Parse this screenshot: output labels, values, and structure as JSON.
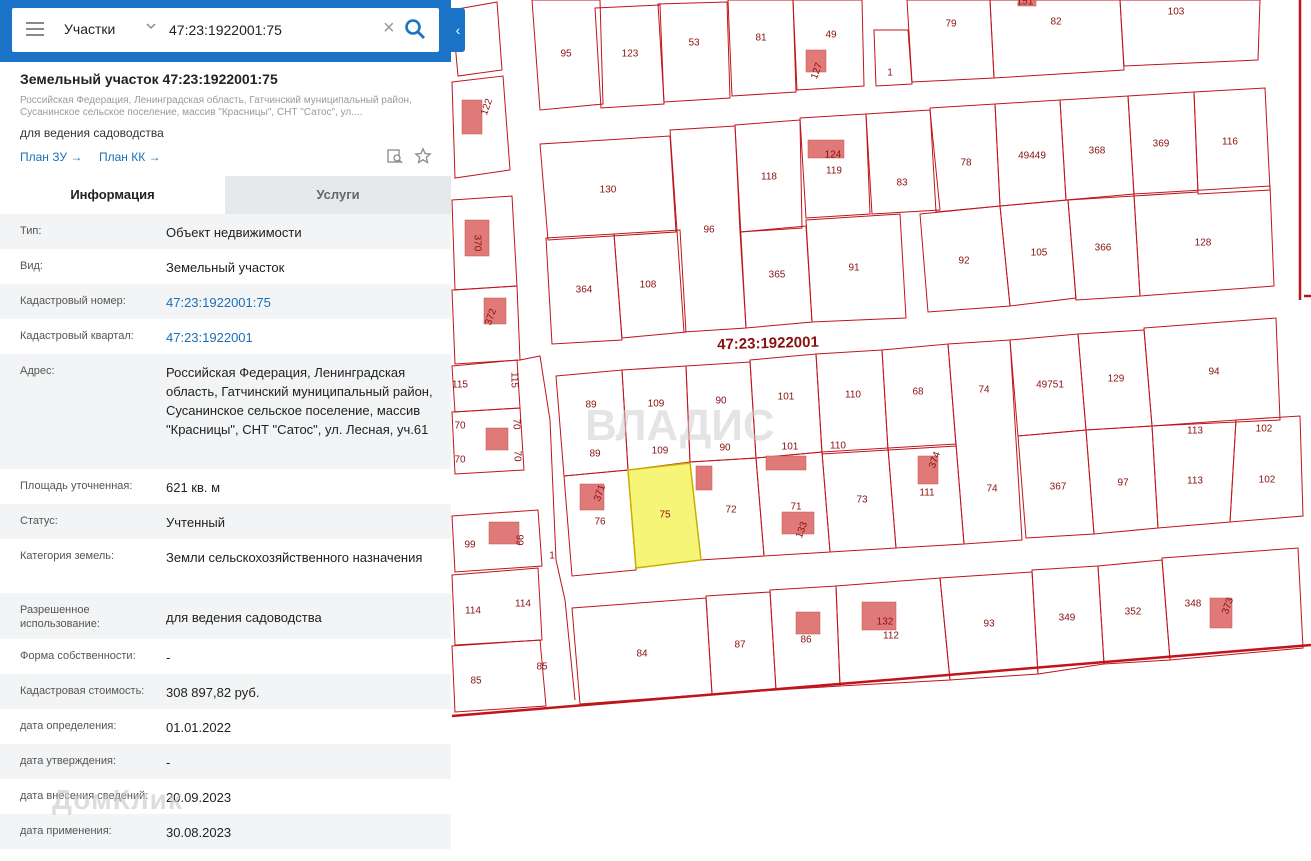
{
  "search": {
    "type_label": "Участки",
    "value": "47:23:1922001:75"
  },
  "card": {
    "title": "Земельный участок 47:23:1922001:75",
    "address_short": "Российская Федерация, Ленинградская область, Гатчинский муниципальный район, Сусанинское сельское поселение, массив \"Красницы\", СНТ \"Сатос\", ул....",
    "usage": "для ведения садоводства",
    "plan_zu": "План ЗУ →",
    "plan_kk": "План КК →"
  },
  "tabs": {
    "info": "Информация",
    "services": "Услуги"
  },
  "details": [
    {
      "key": "Тип:",
      "value": "Объект недвижимости"
    },
    {
      "key": "Вид:",
      "value": "Земельный участок"
    },
    {
      "key": "Кадастровый номер:",
      "value": "47:23:1922001:75"
    },
    {
      "key": "Кадастровый квартал:",
      "value": "47:23:1922001"
    },
    {
      "key": "Адрес:",
      "value": "Российская Федерация, Ленинградская область, Гатчинский муниципальный район, Сусанинское сельское поселение, массив \"Красницы\", СНТ \"Сатос\", ул. Лесная, уч.61"
    },
    {
      "key": "Площадь уточненная:",
      "value": "621 кв. м"
    },
    {
      "key": "Статус:",
      "value": "Учтенный"
    },
    {
      "key": "Категория земель:",
      "value": "Земли сельскохозяйственного назначения"
    },
    {
      "key": "Разрешенное использование:",
      "value": "для ведения садоводства"
    },
    {
      "key": "Форма собственности:",
      "value": "-"
    },
    {
      "key": "Кадастровая стоимость:",
      "value": "308 897,82 руб."
    },
    {
      "key": "дата определения:",
      "value": "01.01.2022"
    },
    {
      "key": "дата утверждения:",
      "value": "-"
    },
    {
      "key": "дата внесения сведений:",
      "value": "20.09.2023"
    },
    {
      "key": "дата применения:",
      "value": "30.08.2023"
    }
  ],
  "map": {
    "quarter_label": "47:23:1922001",
    "watermark_map": "ВЛАДИС",
    "watermark_panel": "ДомКлик",
    "selected_parcel": "75",
    "parcel_labels": [
      "95",
      "123",
      "53",
      "81",
      "49",
      "79",
      "82",
      "103",
      "151",
      "127",
      "1",
      "122",
      "130",
      "96",
      "118",
      "124",
      "119",
      "83",
      "78",
      "49449",
      "368",
      "369",
      "116",
      "370",
      "364",
      "108",
      "365",
      "91",
      "92",
      "105",
      "366",
      "128",
      "372",
      "115",
      "115",
      "89",
      "109",
      "90",
      "101",
      "110",
      "68",
      "74",
      "49751",
      "129",
      "94",
      "70",
      "70",
      "70",
      "70",
      "89",
      "109",
      "90",
      "101",
      "110",
      "113",
      "102",
      "371",
      "76",
      "75",
      "72",
      "71",
      "133",
      "73",
      "374",
      "111",
      "74",
      "367",
      "97",
      "113",
      "102",
      "99",
      "99",
      "1",
      "114",
      "114",
      "84",
      "87",
      "86",
      "132",
      "112",
      "93",
      "349",
      "352",
      "348",
      "373",
      "85",
      "85"
    ]
  },
  "colors": {
    "header_blue": "#1a73c6",
    "parcel_line": "#c0141b",
    "parcel_label": "#8a1010",
    "building_fill": "#e07a78",
    "selected_fill": "#f7f578",
    "link_blue": "#1a6fb8"
  },
  "icons": {
    "menu": "menu-icon",
    "dropdown": "chevron-down-icon",
    "clear": "close-icon",
    "search": "search-icon",
    "collapse": "chevron-left-icon",
    "report": "report-search-icon",
    "favorite": "star-icon"
  }
}
